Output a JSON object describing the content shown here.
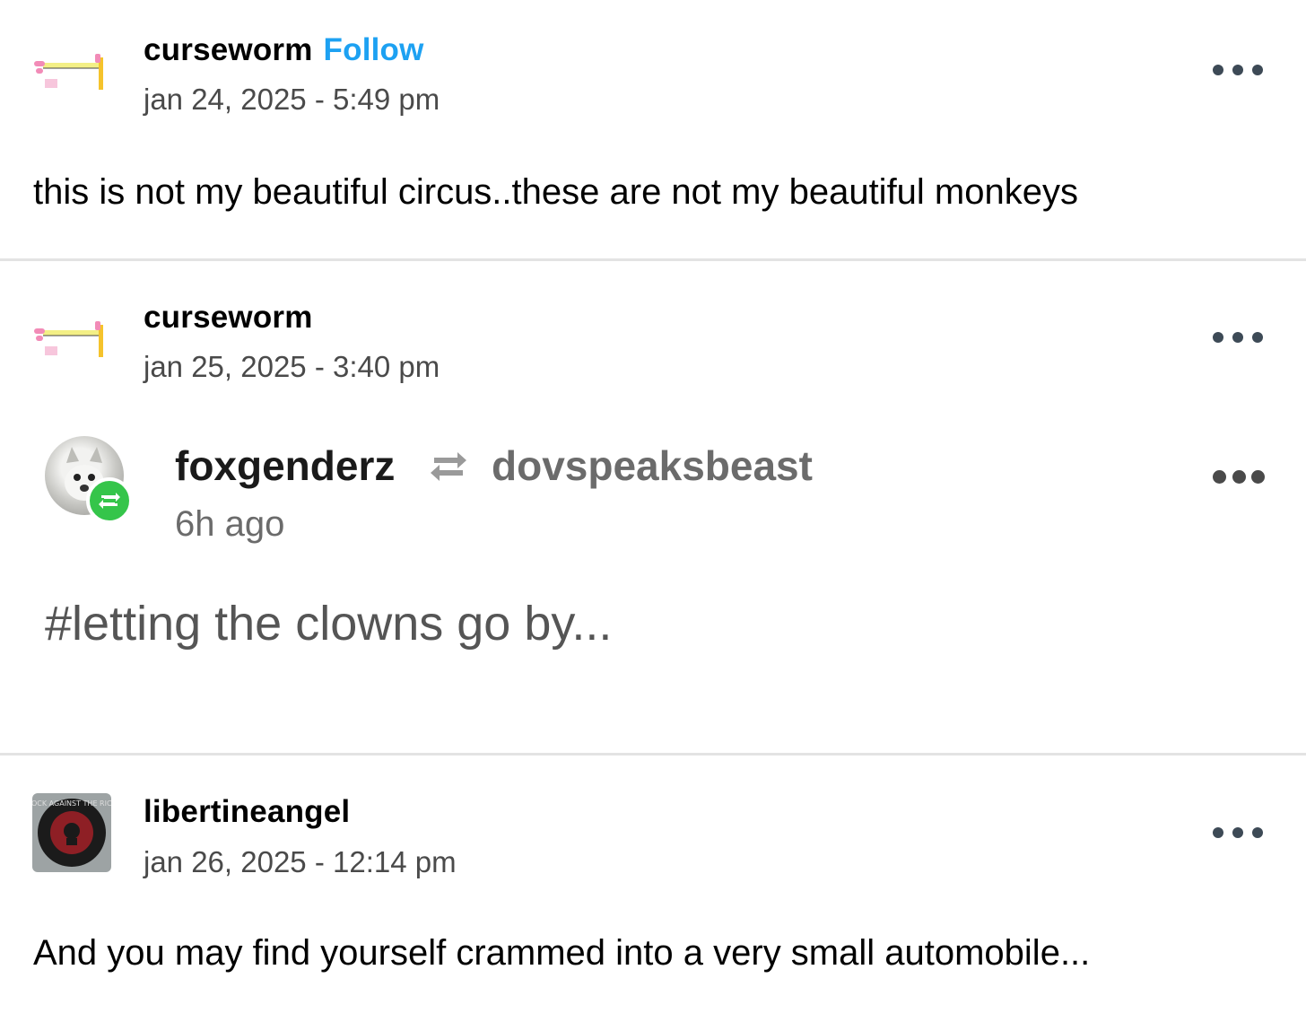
{
  "posts": [
    {
      "username": "curseworm",
      "follow_label": "Follow",
      "timestamp": "jan 24, 2025 - 5:49 pm",
      "text": "this is not my beautiful circus..these are not my beautiful monkeys"
    },
    {
      "username": "curseworm",
      "timestamp": "jan 25, 2025 - 3:40 pm",
      "embed": {
        "username": "foxgenderz",
        "reblogged_from": "dovspeaksbeast",
        "time": "6h ago",
        "tag": "#letting the clowns go by..."
      }
    },
    {
      "username": "libertineangel",
      "timestamp": "jan 26, 2025 - 12:14 pm",
      "avatar_text": "ROCK AGAINST THE RICH",
      "text": "And you may find yourself crammed into a very small automobile..."
    }
  ],
  "colors": {
    "follow": "#1da1f2",
    "divider": "#e3e3e3",
    "reblog_badge": "#35c54a",
    "more_dots": "#3d4a56"
  },
  "icons": [
    "curseworm-avatar",
    "reblog-icon",
    "more-options-icon",
    "libertineangel-avatar"
  ]
}
